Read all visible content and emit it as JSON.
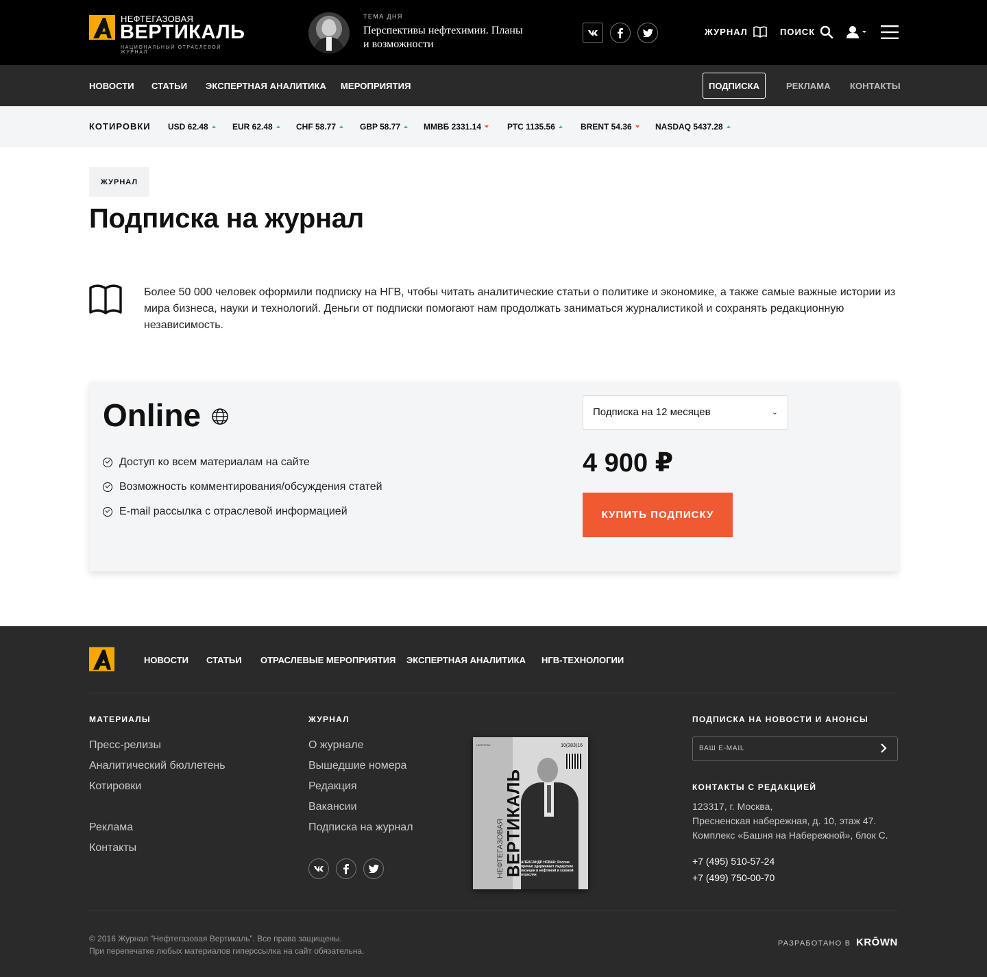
{
  "header": {
    "logo_small": "НЕФТЕГАЗОВАЯ",
    "logo_big": "ВЕРТИКАЛЬ",
    "logo_sub": "НАЦИОНАЛЬНЫЙ ОТРАСЛЕВОЙ ЖУРНАЛ",
    "theme_label": "ТЕМА ДНЯ",
    "theme_text": "Перспективы нефтехимии. Планы и возможности",
    "journal_label": "ЖУРНАЛ",
    "search_label": "ПОИСК",
    "social_icons": [
      "vk-icon",
      "facebook-icon",
      "twitter-icon"
    ]
  },
  "nav": {
    "left": [
      "НОВОСТИ",
      "СТАТЬИ",
      "ЭКСПЕРТНАЯ АНАЛИТИКА",
      "МЕРОПРИЯТИЯ"
    ],
    "subscription": "ПОДПИСКА",
    "ads": "РЕКЛАМА",
    "contacts": "КОНТАКТЫ"
  },
  "quotes": {
    "label": "КОТИРОВКИ",
    "items": [
      {
        "text": "USD 62.48",
        "trend": "up"
      },
      {
        "text": "EUR 62.48",
        "trend": "up"
      },
      {
        "text": "CHF 58.77",
        "trend": "up"
      },
      {
        "text": "GBP 58.77",
        "trend": "up"
      },
      {
        "text": "ММВБ 2331.14",
        "trend": "down"
      },
      {
        "text": "РТС 1135.56",
        "trend": "up"
      },
      {
        "text": "BRENT 54.36",
        "trend": "down"
      },
      {
        "text": "NASDAQ 5437.28",
        "trend": "up"
      }
    ],
    "colors": {
      "up": "#4cb99a",
      "down": "#f05a33"
    }
  },
  "content": {
    "crumb": "ЖУРНАЛ",
    "title": "Подписка на журнал",
    "intro": "Более 50 000 человек оформили подписку на НГВ, чтобы читать аналитические статьи о политике и экономике, а также самые важные истории из мира бизнеса, науки и технологий. Деньги от подписки помогают нам продолжать заниматься журналистикой и сохранять редакционную независимость."
  },
  "plan": {
    "title": "Online",
    "features": [
      "Доступ ко всем материалам на сайте",
      "Возможность комментирования/обсуждения статей",
      "E-mail рассылка с отраслевой информацией"
    ],
    "period_selected": "Подписка на 12 месяцев",
    "price": "4 900 ₽",
    "buy_label": "КУПИТЬ ПОДПИСКУ",
    "accent_color": "#f05a33"
  },
  "footer": {
    "nav": [
      "НОВОСТИ",
      "СТАТЬИ",
      "ОТРАСЛЕВЫЕ МЕРОПРИЯТИЯ",
      "ЭКСПЕРТНАЯ АНАЛИТИКА",
      "НГВ-ТЕХНОЛОГИИ"
    ],
    "materials_head": "МАТЕРИАЛЫ",
    "materials": [
      "Пресс-релизы",
      "Аналитический бюллетень",
      "Котировки"
    ],
    "materials2": [
      "Реклама",
      "Контакты"
    ],
    "journal_head": "ЖУРНАЛ",
    "journal": [
      "О журнале",
      "Вышедшие номера",
      "Редакция",
      "Вакансии",
      "Подписка на журнал"
    ],
    "cover": {
      "title_small": "НЕФТЕГАЗОВАЯ",
      "title_big": "ВЕРТИКАЛЬ",
      "issue": "10(383)16",
      "caption": "АЛЕКСАНДР НОВАК: Россия прочно удерживает лидерские позиции в нефтяной и газовой отраслях"
    },
    "newsletter_head": "ПОДПИСКА НА НОВОСТИ И АНОНСЫ",
    "email_placeholder": "ВАШ E-MAIL",
    "contacts_head": "КОНТАКТЫ С РЕДАКЦИЕЙ",
    "address": [
      "123317, г. Москва,",
      "Пресненская набережная, д. 10, этаж 47.",
      "Комплекс «Башня на Набережной», блок С."
    ],
    "phones": [
      "+7 (495) 510-57-24",
      "+7 (499) 750-00-70"
    ],
    "copyright": [
      "© 2016 Журнал “Нефтегазовая Вертикаль”. Все права защищены.",
      "При перепечатке любых материалов гиперссылка на сайт обязательна."
    ],
    "developed_by": "РАЗРАБОТАНО В",
    "developer": "KRŌWN"
  }
}
